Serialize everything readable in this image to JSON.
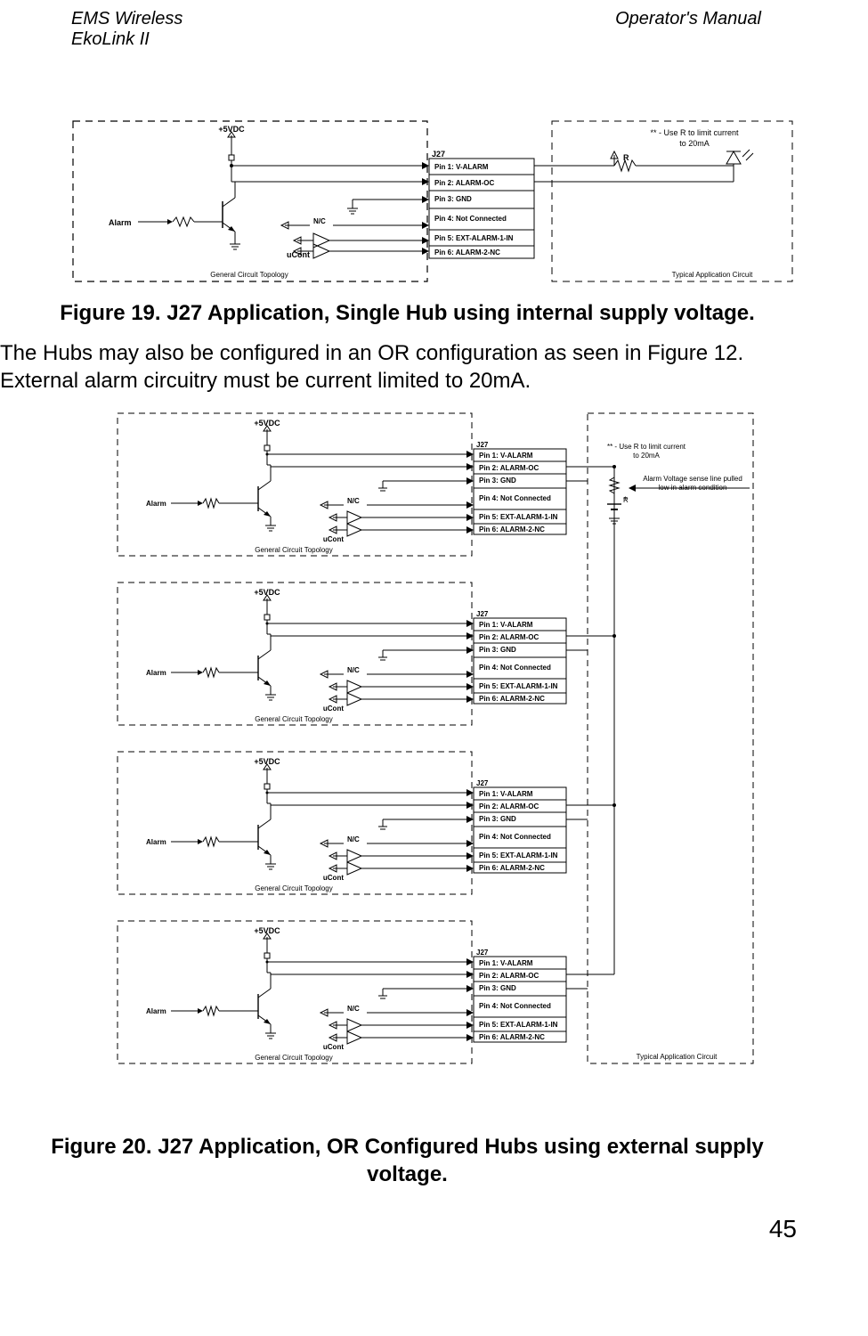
{
  "header": {
    "brand": "EMS Wireless",
    "product": "EkoLink II",
    "doc": "Operator's Manual"
  },
  "fig19": {
    "caption": "Figure 19. J27 Application, Single Hub using internal supply voltage.",
    "voltage": "+5VDC",
    "alarm": "Alarm",
    "nc": "N/C",
    "ucont": "uCont",
    "gct": "General Circuit Topology",
    "tac": "Typical Application Circuit",
    "j27": "J27",
    "pins": [
      "Pin 1: V-ALARM",
      "Pin 2: ALARM-OC",
      "Pin 3: GND",
      "Pin 4: Not Connected",
      "Pin 5: EXT-ALARM-1-IN",
      "Pin 6: ALARM-2-NC"
    ],
    "r": "R",
    "note": "** - Use R to limit current to 20mA"
  },
  "body1": "The Hubs may also be configured in an OR configuration as seen in Figure 12.  External alarm circuitry must be current limited to 20mA.",
  "fig20": {
    "caption": "Figure 20. J27 Application, OR Configured Hubs using external supply voltage.",
    "voltage": "+5VDC",
    "alarm": "Alarm",
    "nc": "N/C",
    "ucont": "uCont",
    "gct": "General Circuit Topology",
    "tac": "Typical Application Circuit",
    "j27": "J27",
    "pins": [
      "Pin 1: V-ALARM",
      "Pin 2: ALARM-OC",
      "Pin 3: GND",
      "Pin 4: Not Connected",
      "Pin 5: EXT-ALARM-1-IN",
      "Pin 6: ALARM-2-NC"
    ],
    "r": "R",
    "note": "** - Use R to limit current to 20mA",
    "sense": "Alarm Voltage sense line pulled low in alarm condition"
  },
  "page_number": "45"
}
